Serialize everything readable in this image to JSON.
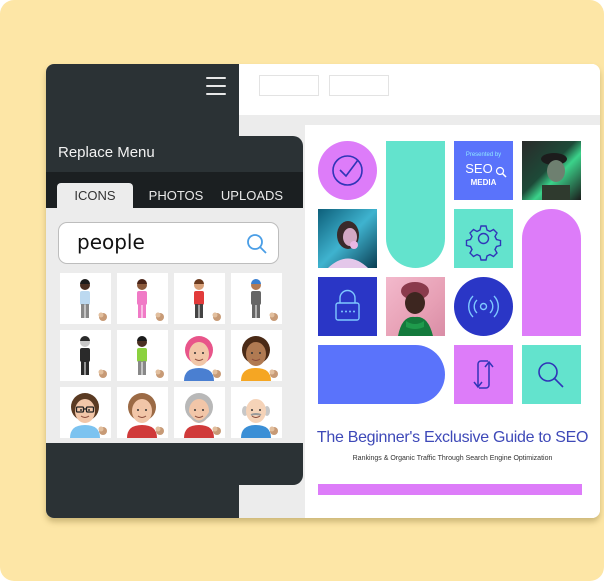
{
  "panel": {
    "title": "Replace Menu",
    "tabs": [
      {
        "label": "ICONS",
        "active": true
      },
      {
        "label": "PHOTOS",
        "active": false
      },
      {
        "label": "UPLOADS",
        "active": false
      }
    ],
    "search": {
      "value": "people",
      "placeholder": ""
    },
    "results": [
      {
        "name": "woman-standing"
      },
      {
        "name": "girl-waving"
      },
      {
        "name": "boy-waving"
      },
      {
        "name": "man-turban"
      },
      {
        "name": "woman-hijab"
      },
      {
        "name": "woman-wheelchair"
      },
      {
        "name": "woman-pink-hair"
      },
      {
        "name": "woman-brown-hair"
      },
      {
        "name": "man-glasses"
      },
      {
        "name": "woman-ponytail"
      },
      {
        "name": "man-gray-beard"
      },
      {
        "name": "man-bald-mustache"
      }
    ]
  },
  "document": {
    "badge": {
      "presented_by": "Presented by",
      "brand_line1": "SEO",
      "brand_line2": "MEDIA"
    },
    "title": "The Beginner's Exclusive Guide to SEO",
    "subtitle": "Rankings & Organic Traffic Through Search Engine Optimization"
  },
  "colors": {
    "background": "#fde6a6",
    "dark": "#2b3235",
    "purple": "#dd7cf9",
    "teal": "#63e3cd",
    "blue": "#5a73fb",
    "navy": "#2a36c6",
    "title_blue": "#3e49b8"
  }
}
